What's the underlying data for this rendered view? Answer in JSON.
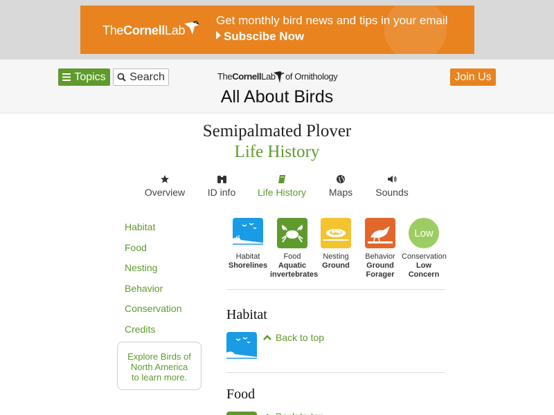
{
  "ad": {
    "logo_the": "The",
    "logo_cornell": "Cornell",
    "logo_lab": "Lab",
    "headline": "Get monthly bird news and tips in your email",
    "cta": "Subscibe Now"
  },
  "header": {
    "topics_label": "Topics",
    "search_label": "Search",
    "join_label": "Join Us",
    "logo_the": "The",
    "logo_cornell": "Cornell",
    "logo_lab": "Lab",
    "logo_of": "of Ornithology",
    "site_title": "All About Birds"
  },
  "page": {
    "species": "Semipalmated Plover",
    "subtitle": "Life History"
  },
  "tabs": [
    {
      "label": "Overview",
      "icon": "star-icon"
    },
    {
      "label": "ID info",
      "icon": "binoculars-icon"
    },
    {
      "label": "Life History",
      "icon": "book-icon",
      "active": true
    },
    {
      "label": "Maps",
      "icon": "globe-icon"
    },
    {
      "label": "Sounds",
      "icon": "speaker-icon"
    }
  ],
  "leftnav": {
    "items": [
      "Habitat",
      "Food",
      "Nesting",
      "Behavior",
      "Conservation",
      "Credits"
    ],
    "explore_line1": "Explore Birds of",
    "explore_line2": "North America",
    "explore_line3": "to learn more."
  },
  "summary": [
    {
      "category": "Habitat",
      "value": "Shorelines",
      "icon": "shoreline-icon",
      "color": "#1a9be6"
    },
    {
      "category": "Food",
      "value_line1": "Aquatic",
      "value_line2": "invertebrates",
      "icon": "crab-icon",
      "color": "#5f9a2d"
    },
    {
      "category": "Nesting",
      "value": "Ground",
      "icon": "ground-nest-icon",
      "color": "#f4c430"
    },
    {
      "category": "Behavior",
      "value_line1": "Ground",
      "value_line2": "Forager",
      "icon": "ground-forager-icon",
      "color": "#e2672a"
    },
    {
      "category": "Conservation",
      "value_line1": "Low",
      "value_line2": "Concern",
      "badge": "Low",
      "color": "#9ccd63"
    }
  ],
  "sections": {
    "habitat_title": "Habitat",
    "food_title": "Food",
    "back_to_top": "Back to top"
  },
  "colors": {
    "accent_green": "#5f9a2d",
    "accent_orange": "#e8831f"
  }
}
